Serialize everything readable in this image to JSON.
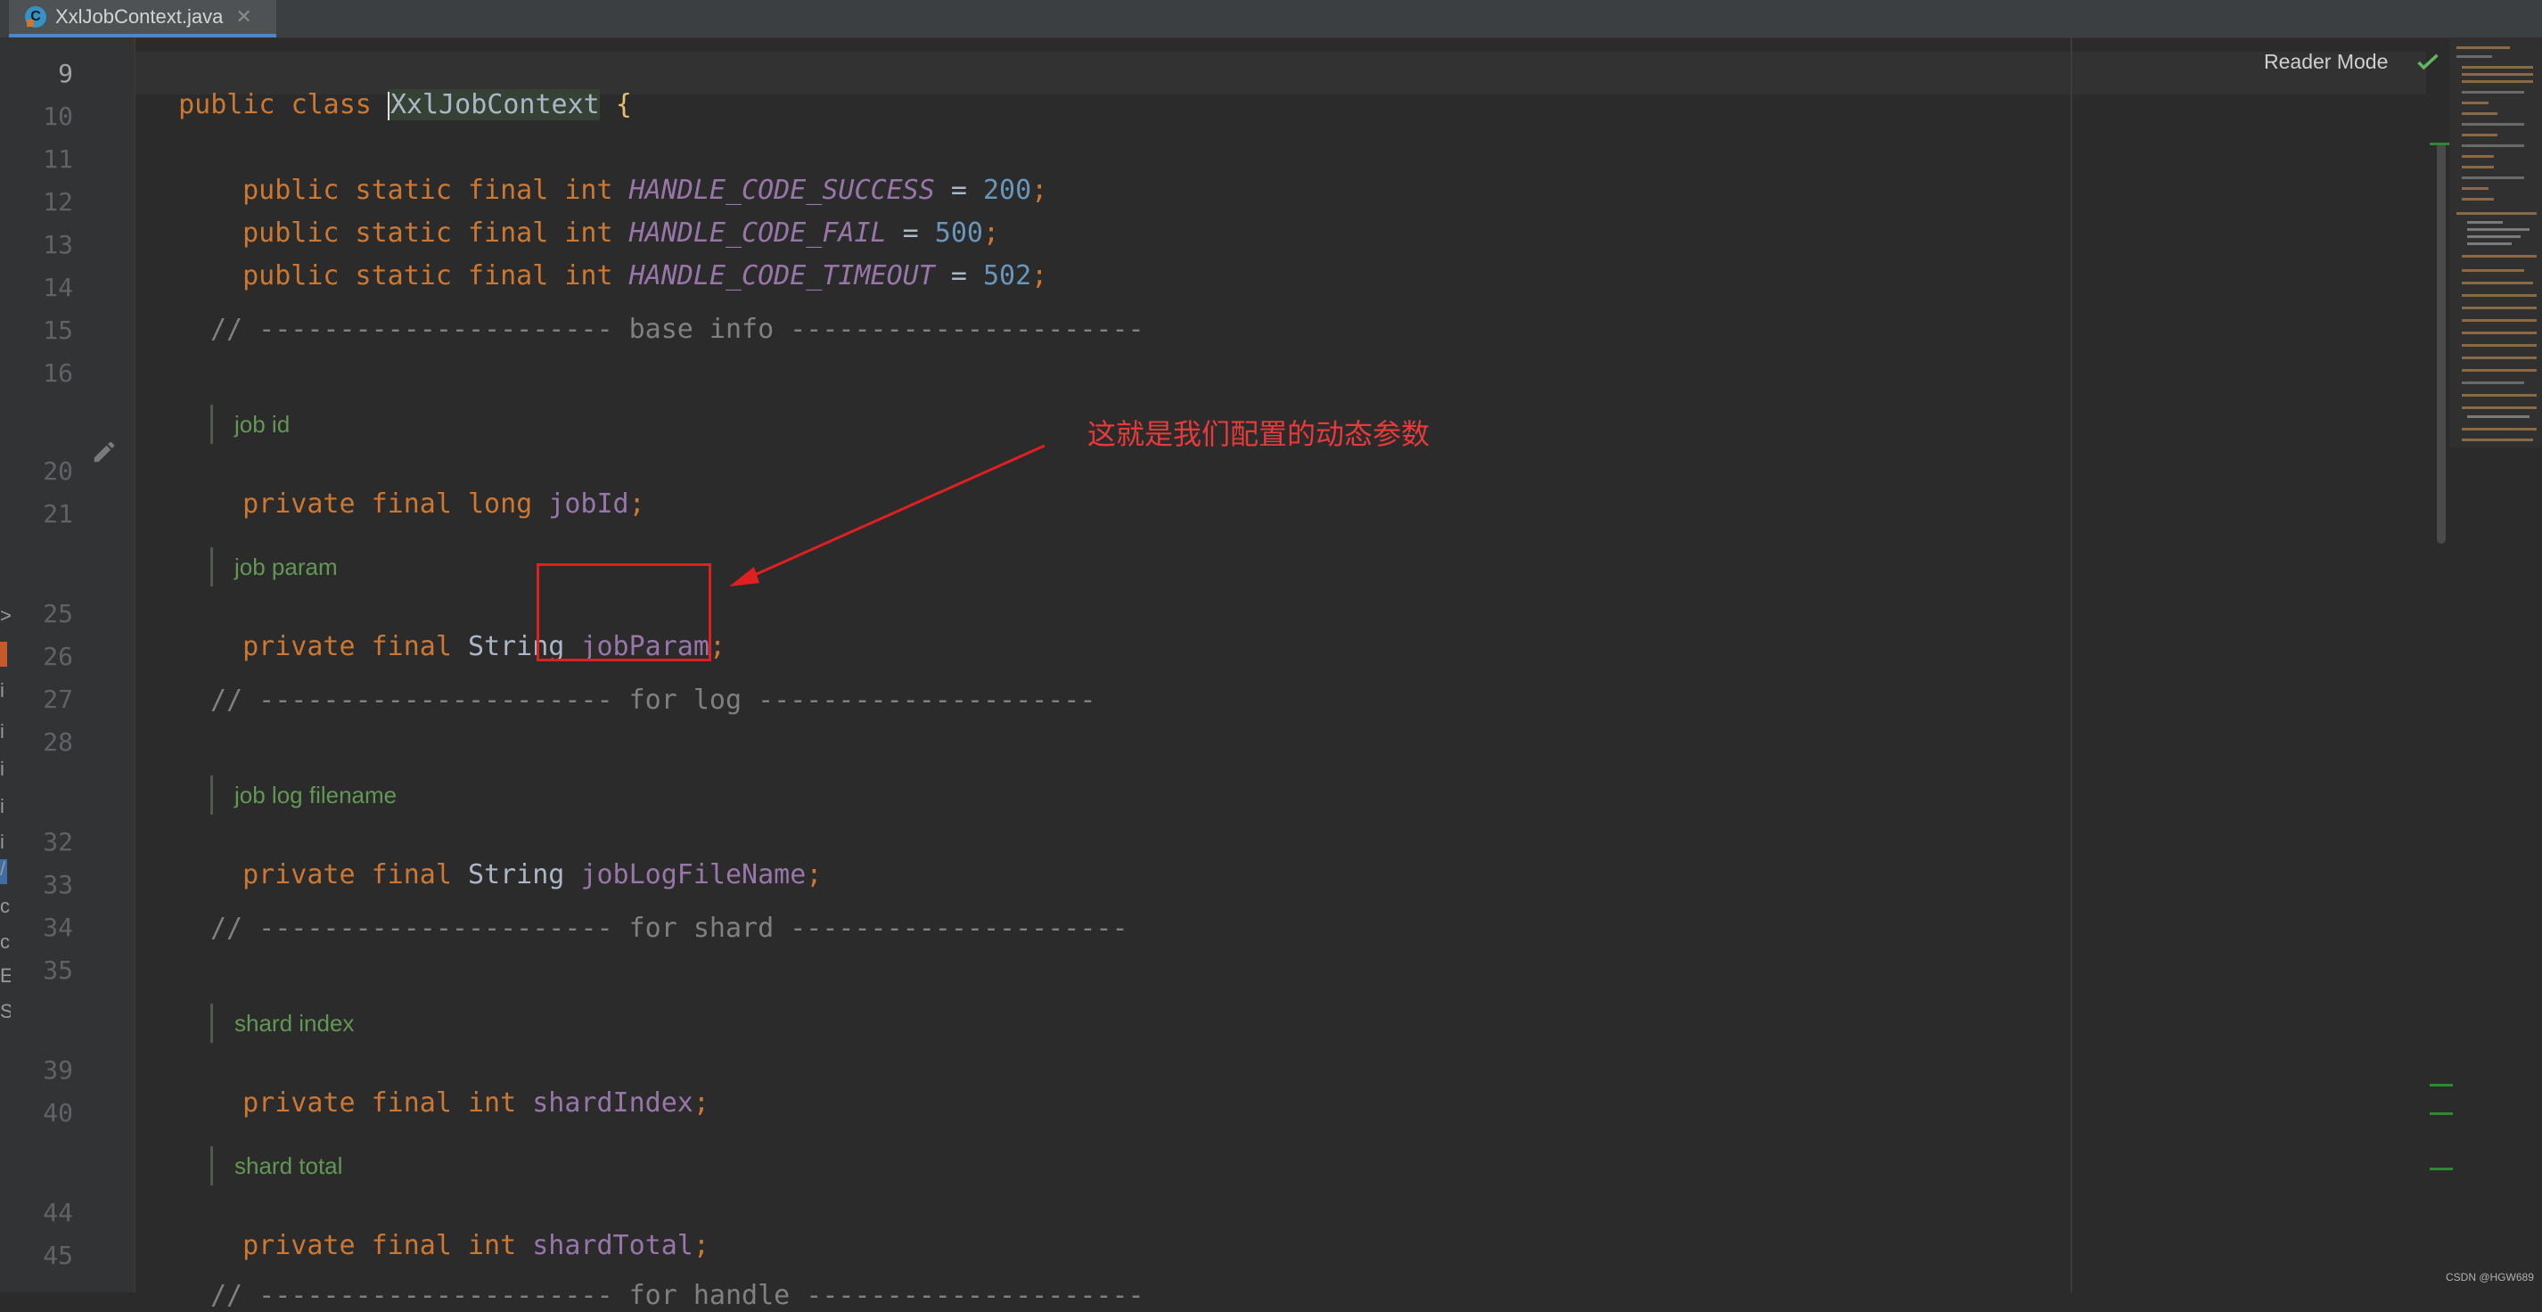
{
  "tab": {
    "icon_letter": "C",
    "filename": "XxlJobContext.java",
    "close": "✕"
  },
  "left_strip_chars": [
    ">",
    "i",
    "i",
    "i",
    "i",
    "i",
    "/",
    "c",
    "c",
    "E",
    "S"
  ],
  "gutter": {
    "line_numbers": [
      "9",
      "10",
      "11",
      "12",
      "13",
      "14",
      "15",
      "16",
      "20",
      "21",
      "25",
      "26",
      "27",
      "28",
      "32",
      "33",
      "34",
      "35",
      "39",
      "40",
      "44",
      "45"
    ]
  },
  "code": {
    "line9": {
      "kw1": "public",
      "kw2": "class",
      "class_name": "XxlJobContext",
      "brace": "{"
    },
    "line11": {
      "mods": "public static final int",
      "name": "HANDLE_CODE_SUCCESS",
      "eq": "=",
      "value": "200",
      "semi": ";"
    },
    "line12": {
      "mods": "public static final int",
      "name": "HANDLE_CODE_FAIL",
      "eq": "=",
      "value": "500",
      "semi": ";"
    },
    "line13": {
      "mods": "public static final int",
      "name": "HANDLE_CODE_TIMEOUT",
      "eq": "=",
      "value": "502",
      "semi": ";"
    },
    "line15": "// ---------------------- base info ----------------------",
    "doc_job_id": "job id",
    "line20": {
      "mods": "private final long",
      "name": "jobId",
      "semi": ";"
    },
    "doc_job_param": "job param",
    "line25": {
      "mods": "private final",
      "type": "String",
      "name": "jobParam",
      "semi": ";"
    },
    "line27": "// ---------------------- for log ---------------------",
    "doc_job_log": "job log filename",
    "line32": {
      "mods": "private final",
      "type": "String",
      "name": "jobLogFileName",
      "semi": ";"
    },
    "line34": "// ---------------------- for shard ---------------------",
    "doc_shard_index": "shard index",
    "line39": {
      "mods": "private final int",
      "name": "shardIndex",
      "semi": ";"
    },
    "doc_shard_total": "shard total",
    "line44": {
      "mods": "private final int",
      "name": "shardTotal",
      "semi": ";"
    },
    "line46_partial": "// ---------------------- for handle ---------------------"
  },
  "annotation": {
    "text": "这就是我们配置的动态参数",
    "color": "#e02020"
  },
  "toolbar": {
    "reader_mode": "Reader Mode"
  },
  "colors": {
    "keyword": "#cc7832",
    "constant": "#9876aa",
    "number": "#6897bb",
    "comment": "#808080",
    "doc": "#629755",
    "text": "#a9b7c6",
    "background": "#2b2b2b"
  },
  "watermark": "CSDN @HGW689"
}
